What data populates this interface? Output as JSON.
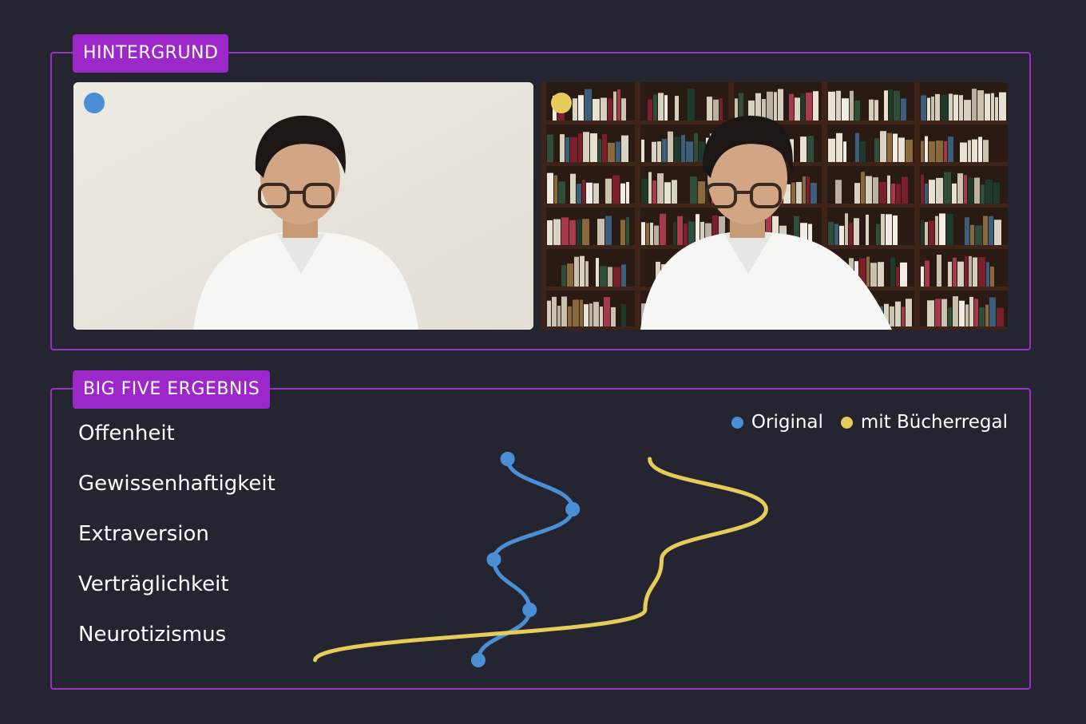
{
  "panels": {
    "background_tag": "HINTERGRUND",
    "result_tag": "BIG FIVE ERGEBNIS"
  },
  "images": {
    "left": {
      "marker_color": "#4a8fd6"
    },
    "right": {
      "marker_color": "#e6cc5a"
    }
  },
  "colors": {
    "accent": "#9c2fc4",
    "series_original": "#4a8fd6",
    "series_bookshelf": "#e6cc5a",
    "background": "#252532"
  },
  "chart_data": {
    "type": "line",
    "orientation": "horizontal",
    "categories": [
      "Offenheit",
      "Gewissenhaftigkeit",
      "Extraversion",
      "Verträglichkeit",
      "Neurotizismus"
    ],
    "xlim": [
      0,
      100
    ],
    "series": [
      {
        "name": "Original",
        "color": "#4a8fd6",
        "values": [
          46.4,
          53.5,
          44.9,
          48.8,
          43.2
        ],
        "markers": true
      },
      {
        "name": "mit Bücherregal",
        "color": "#e6cc5a",
        "values": [
          61.9,
          74.6,
          63.2,
          61.4,
          25.4
        ],
        "markers": false
      }
    ],
    "legend_position": "top-right",
    "grid": false
  }
}
